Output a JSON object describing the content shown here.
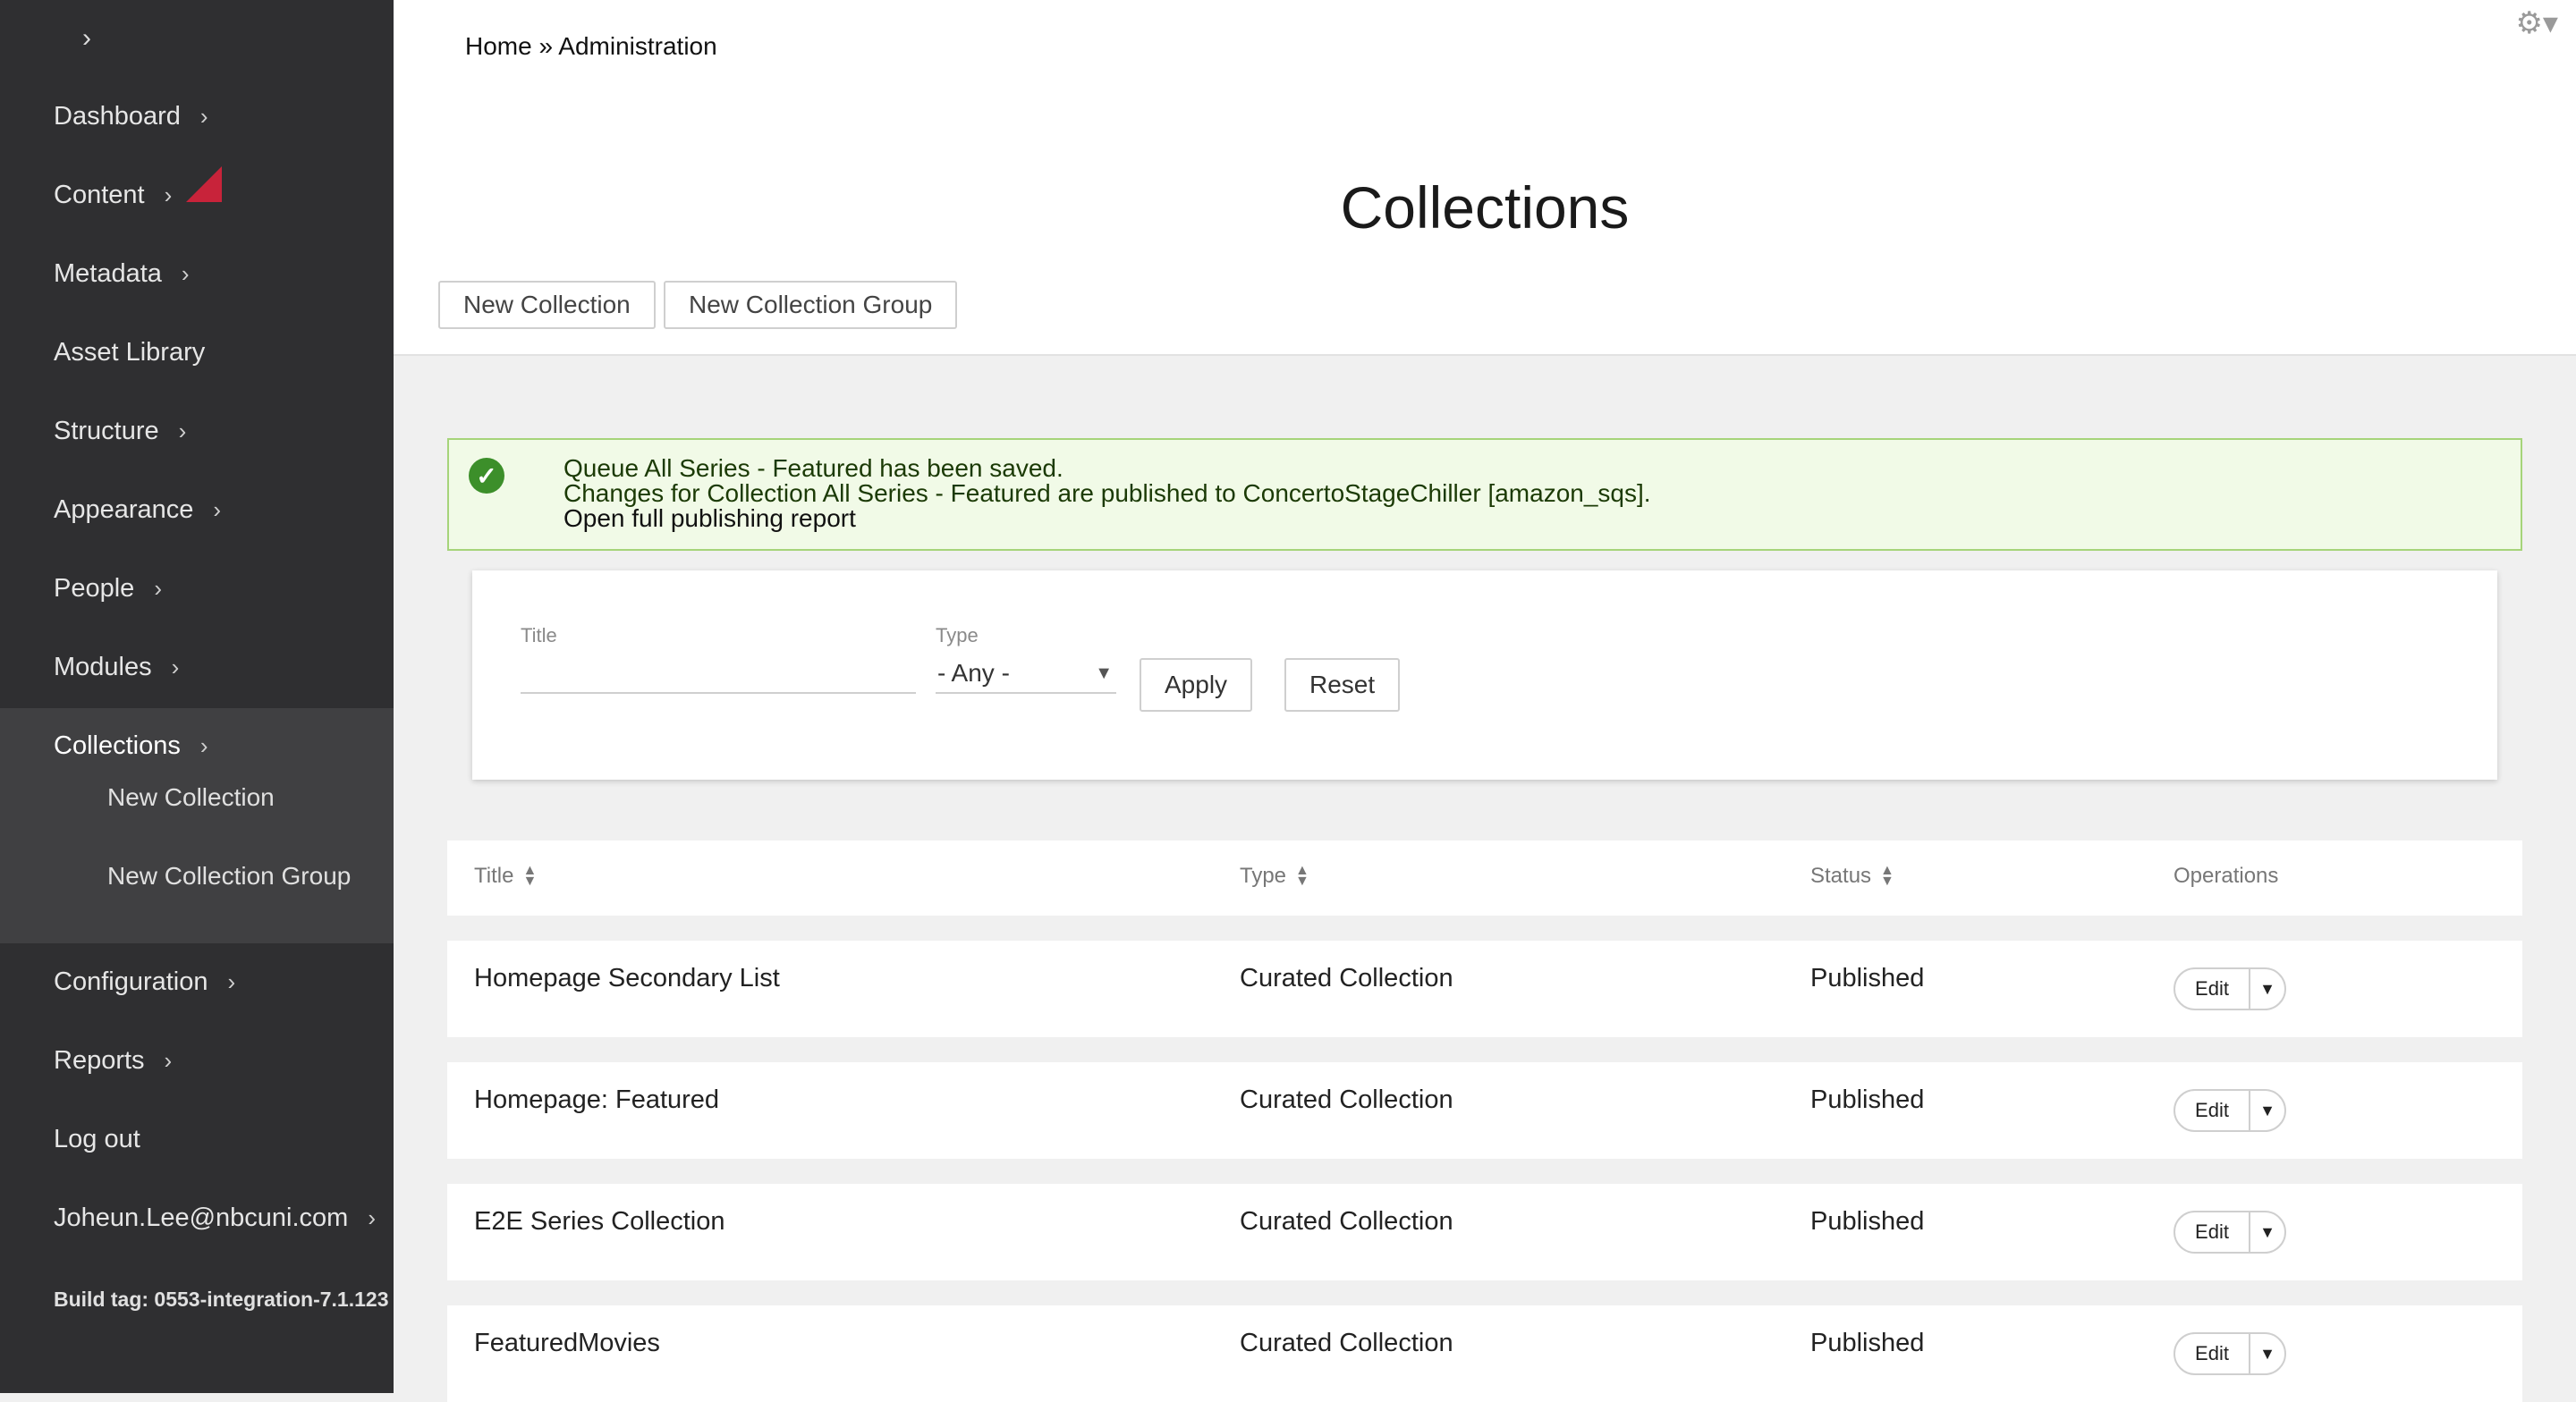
{
  "sidebar": {
    "items": [
      {
        "label": "Dashboard",
        "has_chevron": true
      },
      {
        "label": "Content",
        "has_chevron": true
      },
      {
        "label": "Metadata",
        "has_chevron": true
      },
      {
        "label": "Asset Library",
        "has_chevron": false
      },
      {
        "label": "Structure",
        "has_chevron": true
      },
      {
        "label": "Appearance",
        "has_chevron": true
      },
      {
        "label": "People",
        "has_chevron": true
      },
      {
        "label": "Modules",
        "has_chevron": true
      },
      {
        "label": "Collections",
        "has_chevron": true,
        "active": true
      },
      {
        "label": "Configuration",
        "has_chevron": true
      },
      {
        "label": "Reports",
        "has_chevron": true
      },
      {
        "label": "Log out",
        "has_chevron": false
      },
      {
        "label": "Joheun.Lee@nbcuni.com",
        "has_chevron": true
      }
    ],
    "sub_items": [
      "New Collection",
      "New Collection Group"
    ],
    "build_tag": "Build tag: 0553-integration-7.1.123",
    "chevron": "›",
    "toggle": "›"
  },
  "breadcrumb": "Home » Administration",
  "page_title": "Collections",
  "actions": {
    "new_collection": "New Collection",
    "new_collection_group": "New Collection Group"
  },
  "message": {
    "lines": [
      "Queue All Series - Featured has been saved.",
      "Changes for Collection All Series - Featured are published to ConcertoStageChiller [amazon_sqs].",
      "Open full publishing report"
    ]
  },
  "filters": {
    "title_label": "Title",
    "title_value": "",
    "type_label": "Type",
    "type_selected": "- Any -",
    "apply": "Apply",
    "reset": "Reset"
  },
  "table": {
    "headers": [
      "Title",
      "Type",
      "Status",
      "Operations"
    ],
    "rows": [
      {
        "title": "Homepage Secondary List",
        "type": "Curated Collection",
        "status": "Published",
        "op": "Edit"
      },
      {
        "title": "Homepage: Featured",
        "type": "Curated Collection",
        "status": "Published",
        "op": "Edit"
      },
      {
        "title": "E2E Series Collection",
        "type": "Curated Collection",
        "status": "Published",
        "op": "Edit"
      },
      {
        "title": "FeaturedMovies",
        "type": "Curated Collection",
        "status": "Published",
        "op": "Edit"
      }
    ]
  },
  "colors": {
    "sidebar_bg": "#2f2f31",
    "active_bg": "#404042",
    "content_flag": "#c8233a",
    "success_bg": "#f1fae7",
    "success_border": "#a6d47a",
    "success_icon": "#3c8f2a"
  },
  "icons": {
    "gear": "gear-icon",
    "success": "check-circle-icon",
    "sort": "sort-icon",
    "caret": "caret-down-icon"
  }
}
